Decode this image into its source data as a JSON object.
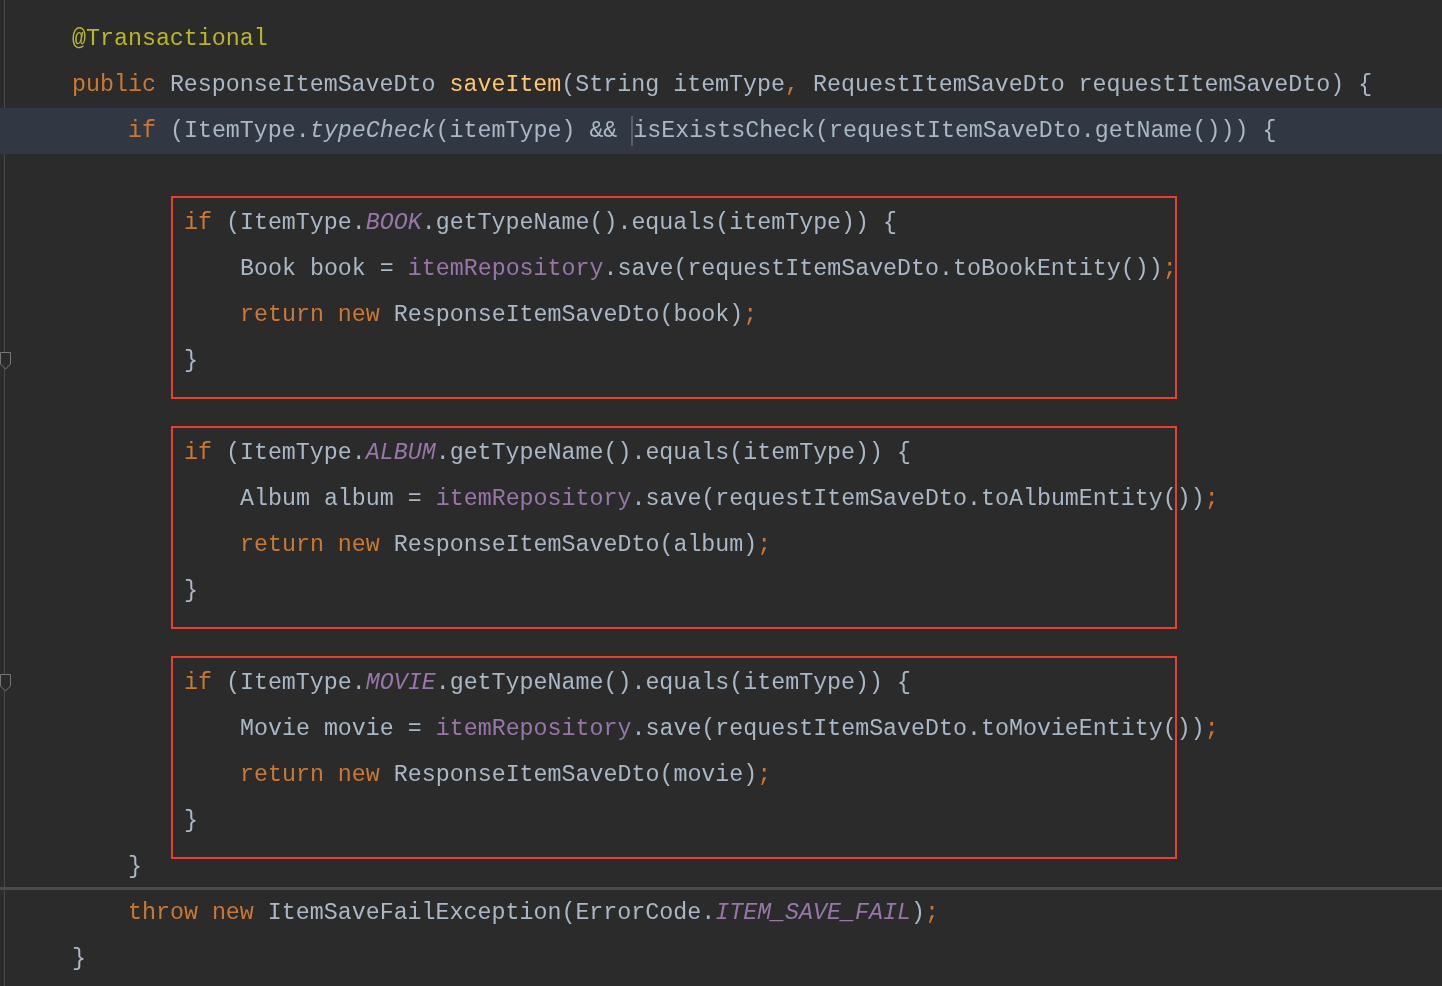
{
  "editor": {
    "lines": [
      {
        "kind": "code",
        "tokens": [
          {
            "text": "@Transactional",
            "kind": "annotation"
          }
        ]
      },
      {
        "kind": "code",
        "tokens": [
          {
            "text": "public ",
            "kind": "keyword"
          },
          {
            "text": "ResponseItemSaveDto ",
            "kind": "plain"
          },
          {
            "text": "saveItem",
            "kind": "method"
          },
          {
            "text": "(String itemType",
            "kind": "plain"
          },
          {
            "text": ", ",
            "kind": "keyword"
          },
          {
            "text": "RequestItemSaveDto requestItemSaveDto) {",
            "kind": "plain"
          }
        ],
        "children": [
          {
            "kind": "code",
            "selected": true,
            "tokens": [
              {
                "text": "if ",
                "kind": "keyword"
              },
              {
                "text": "(ItemType.",
                "kind": "plain"
              },
              {
                "text": "typeCheck",
                "kind": "static-method"
              },
              {
                "text": "(itemType) && ",
                "kind": "plain"
              },
              {
                "text": "isExistsCheck(requestItemSaveDto.getName())) {",
                "kind": "plain",
                "caret_before": true
              }
            ],
            "children": [
              {
                "kind": "blank"
              },
              {
                "kind": "box",
                "lines": [
                  {
                    "kind": "code",
                    "tokens": [
                      {
                        "text": "if ",
                        "kind": "keyword"
                      },
                      {
                        "text": "(ItemType.",
                        "kind": "plain"
                      },
                      {
                        "text": "BOOK",
                        "kind": "static"
                      },
                      {
                        "text": ".getTypeName().equals(itemType)) {",
                        "kind": "plain"
                      }
                    ],
                    "children": [
                      {
                        "kind": "code",
                        "tokens": [
                          {
                            "text": "Book book = ",
                            "kind": "plain"
                          },
                          {
                            "text": "itemRepository",
                            "kind": "field"
                          },
                          {
                            "text": ".save(requestItemSaveDto.toBookEntity())",
                            "kind": "plain"
                          },
                          {
                            "text": ";",
                            "kind": "keyword"
                          }
                        ]
                      },
                      {
                        "kind": "code",
                        "tokens": [
                          {
                            "text": "return new ",
                            "kind": "keyword"
                          },
                          {
                            "text": "ResponseItemSaveDto(book)",
                            "kind": "plain"
                          },
                          {
                            "text": ";",
                            "kind": "keyword"
                          }
                        ]
                      }
                    ]
                  },
                  {
                    "kind": "code",
                    "fold": true,
                    "tokens": [
                      {
                        "text": "}",
                        "kind": "plain"
                      }
                    ]
                  }
                ]
              },
              {
                "kind": "blank"
              },
              {
                "kind": "box",
                "lines": [
                  {
                    "kind": "code",
                    "tokens": [
                      {
                        "text": "if ",
                        "kind": "keyword"
                      },
                      {
                        "text": "(ItemType.",
                        "kind": "plain"
                      },
                      {
                        "text": "ALBUM",
                        "kind": "static"
                      },
                      {
                        "text": ".getTypeName().equals(itemType)) {",
                        "kind": "plain"
                      }
                    ],
                    "children": [
                      {
                        "kind": "code",
                        "tokens": [
                          {
                            "text": "Album album = ",
                            "kind": "plain"
                          },
                          {
                            "text": "itemRepository",
                            "kind": "field"
                          },
                          {
                            "text": ".save(requestItemSaveDto.toAlbumEntity())",
                            "kind": "plain"
                          },
                          {
                            "text": ";",
                            "kind": "keyword"
                          }
                        ]
                      },
                      {
                        "kind": "code",
                        "tokens": [
                          {
                            "text": "return new ",
                            "kind": "keyword"
                          },
                          {
                            "text": "ResponseItemSaveDto(album)",
                            "kind": "plain"
                          },
                          {
                            "text": ";",
                            "kind": "keyword"
                          }
                        ]
                      }
                    ]
                  },
                  {
                    "kind": "code",
                    "tokens": [
                      {
                        "text": "}",
                        "kind": "plain"
                      }
                    ]
                  }
                ]
              },
              {
                "kind": "blank"
              },
              {
                "kind": "box",
                "lines": [
                  {
                    "kind": "code",
                    "fold": true,
                    "tokens": [
                      {
                        "text": "if ",
                        "kind": "keyword"
                      },
                      {
                        "text": "(ItemType.",
                        "kind": "plain"
                      },
                      {
                        "text": "MOVIE",
                        "kind": "static"
                      },
                      {
                        "text": ".getTypeName().equals(itemType)) {",
                        "kind": "plain"
                      }
                    ],
                    "children": [
                      {
                        "kind": "code",
                        "tokens": [
                          {
                            "text": "Movie movie = ",
                            "kind": "plain"
                          },
                          {
                            "text": "itemRepository",
                            "kind": "field"
                          },
                          {
                            "text": ".save(requestItemSaveDto.toMovieEntity())",
                            "kind": "plain"
                          },
                          {
                            "text": ";",
                            "kind": "keyword"
                          }
                        ]
                      },
                      {
                        "kind": "code",
                        "tokens": [
                          {
                            "text": "return new ",
                            "kind": "keyword"
                          },
                          {
                            "text": "ResponseItemSaveDto(movie)",
                            "kind": "plain"
                          },
                          {
                            "text": ";",
                            "kind": "keyword"
                          }
                        ]
                      }
                    ]
                  },
                  {
                    "kind": "code",
                    "tokens": [
                      {
                        "text": "}",
                        "kind": "plain"
                      }
                    ]
                  }
                ]
              }
            ]
          },
          {
            "kind": "code",
            "separator_after": true,
            "tokens": [
              {
                "text": "}",
                "kind": "plain"
              }
            ]
          },
          {
            "kind": "code",
            "tokens": [
              {
                "text": "throw new ",
                "kind": "keyword"
              },
              {
                "text": "ItemSaveFailException(ErrorCode.",
                "kind": "plain"
              },
              {
                "text": "ITEM_SAVE_FAIL",
                "kind": "static"
              },
              {
                "text": ")",
                "kind": "plain"
              },
              {
                "text": ";",
                "kind": "keyword"
              }
            ]
          }
        ]
      },
      {
        "kind": "code",
        "tokens": [
          {
            "text": "}",
            "kind": "plain"
          }
        ]
      }
    ]
  }
}
